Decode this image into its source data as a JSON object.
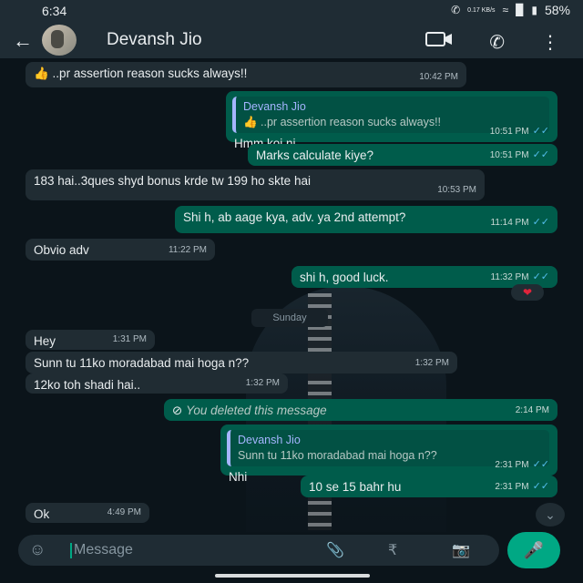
{
  "status": {
    "time": "6:34",
    "speed": "0.17 KB/s",
    "battery": "58%"
  },
  "header": {
    "contact_name": "Devansh Jio"
  },
  "messages": {
    "m1": {
      "text": "👍 ..pr assertion reason sucks always!!",
      "time": "10:42 PM"
    },
    "m2": {
      "quote_name": "Devansh Jio",
      "quote_text": "👍 ..pr assertion reason sucks always!!",
      "text": "Hmm koi ni",
      "time": "10:51 PM"
    },
    "m3": {
      "text": "Marks calculate kiye?",
      "time": "10:51 PM"
    },
    "m4": {
      "text": "183 hai..3ques shyd bonus krde tw 199 ho skte hai",
      "time": "10:53 PM"
    },
    "m5": {
      "text": "Shi h, ab aage kya, adv. ya 2nd attempt?",
      "time": "11:14 PM"
    },
    "m6": {
      "text": "Obvio adv",
      "time": "11:22 PM"
    },
    "m7": {
      "text": "shi h, good luck.",
      "time": "11:32 PM"
    },
    "day_sep": "Sunday",
    "m8": {
      "text": "Hey",
      "time": "1:31 PM"
    },
    "m9": {
      "text": "Sunn tu 11ko moradabad mai hoga n??",
      "time": "1:32 PM"
    },
    "m10": {
      "text": "12ko toh shadi hai..",
      "time": "1:32 PM"
    },
    "m11": {
      "text": "You deleted this message",
      "time": "2:14 PM"
    },
    "m12": {
      "quote_name": "Devansh Jio",
      "quote_text": "Sunn tu 11ko moradabad mai hoga n??",
      "text": "Nhi",
      "time": "2:31 PM"
    },
    "m13": {
      "text": "10 se 15 bahr hu",
      "time": "2:31 PM"
    },
    "m14": {
      "text": "Ok",
      "time": "4:49 PM"
    }
  },
  "composer": {
    "placeholder": "Message"
  },
  "icons": [
    "back-arrow-icon",
    "video-call-icon",
    "voice-call-icon",
    "more-options-icon",
    "emoji-icon",
    "attach-icon",
    "rupee-icon",
    "camera-icon",
    "mic-icon",
    "scroll-down-icon",
    "heart-reaction-icon",
    "double-tick-icon",
    "blocked-icon"
  ],
  "colors": {
    "incoming": "#202c33",
    "outgoing": "#005c4b",
    "accent": "#00a884",
    "read_ticks": "#53bdeb"
  }
}
